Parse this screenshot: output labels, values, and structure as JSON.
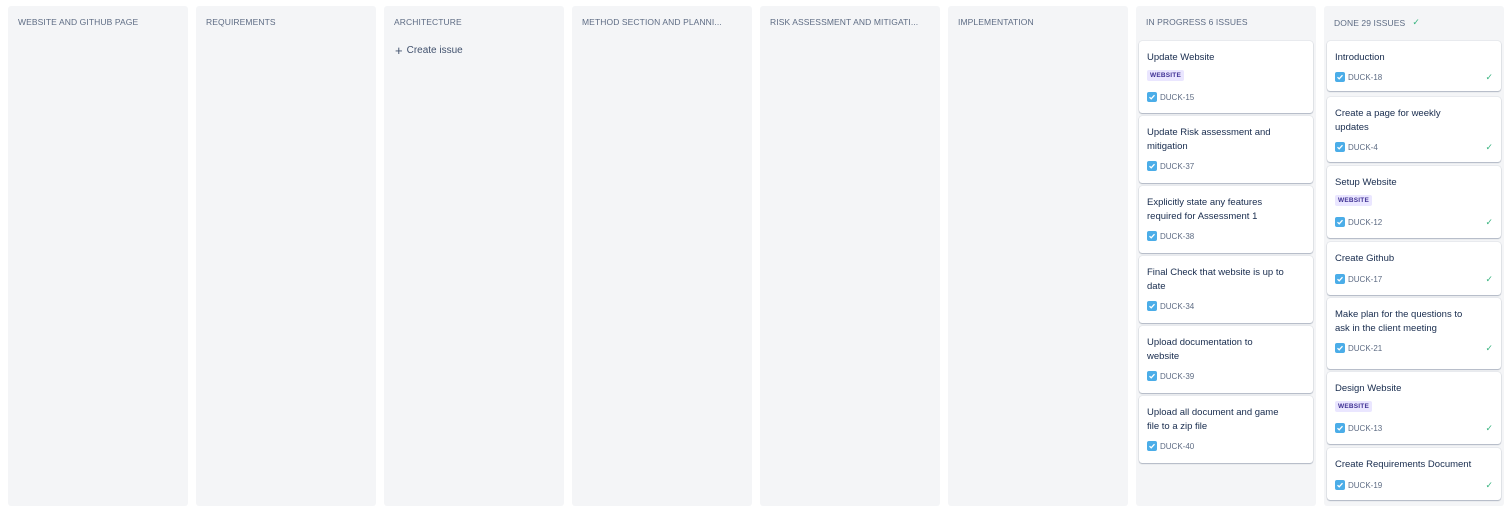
{
  "columns": [
    {
      "title": "WEBSITE AND GITHUB PAGE"
    },
    {
      "title": "REQUIREMENTS"
    },
    {
      "title": "ARCHITECTURE"
    },
    {
      "title": "METHOD SECTION AND PLANNI..."
    },
    {
      "title": "RISK ASSESSMENT AND MITIGATI..."
    },
    {
      "title": "IMPLEMENTATION"
    },
    {
      "title": "IN PROGRESS 6 ISSUES"
    },
    {
      "title": "DONE 29 ISSUES"
    }
  ],
  "create_issue_label": "Create issue",
  "in_progress_cards": [
    {
      "title": "Update Website",
      "label": "WEBSITE",
      "key": "DUCK-15"
    },
    {
      "title": "Update Risk assessment and mitigation",
      "key": "DUCK-37"
    },
    {
      "title": "Explicitly state any features required for Assessment 1",
      "key": "DUCK-38"
    },
    {
      "title": "Final Check that website is up to date",
      "key": "DUCK-34"
    },
    {
      "title": "Upload documentation to website",
      "key": "DUCK-39"
    },
    {
      "title": "Upload all document and game file to a zip file",
      "key": "DUCK-40"
    }
  ],
  "done_cards": [
    {
      "title": "Introduction",
      "key": "DUCK-18"
    },
    {
      "title": "Create a page for weekly updates",
      "key": "DUCK-4"
    },
    {
      "title": "Setup Website",
      "label": "WEBSITE",
      "key": "DUCK-12"
    },
    {
      "title": "Create Github",
      "key": "DUCK-17"
    },
    {
      "title": "Make plan for the questions to ask in the client meeting",
      "key": "DUCK-21"
    },
    {
      "title": "Design Website",
      "label": "WEBSITE",
      "key": "DUCK-13"
    },
    {
      "title": "Create Requirements Document",
      "key": "DUCK-19"
    }
  ],
  "icons": {
    "task": "task-checkbox-icon",
    "done": "check-icon",
    "create": "plus-icon"
  },
  "colors": {
    "column_bg": "#f4f5f7",
    "label_bg": "#eae6ff",
    "label_text": "#403294",
    "task_icon": "#4bade8",
    "done_check": "#36b37e"
  }
}
